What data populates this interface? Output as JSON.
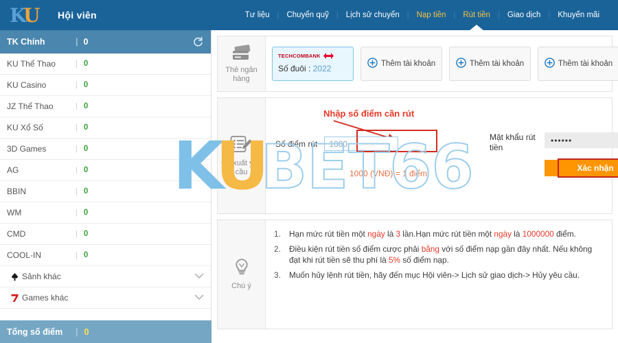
{
  "header": {
    "logo_alt": "KU",
    "brand_title": "Hội viên",
    "nav": [
      {
        "label": "Tư liệu",
        "state": "normal"
      },
      {
        "label": "Chuyển quỹ",
        "state": "normal"
      },
      {
        "label": "Lịch sử chuyển",
        "state": "normal"
      },
      {
        "label": "Nạp tiền",
        "state": "highlight"
      },
      {
        "label": "Rút tiền",
        "state": "active"
      },
      {
        "label": "Giao dịch",
        "state": "normal"
      },
      {
        "label": "Khuyến mãi",
        "state": "normal"
      }
    ],
    "separator": "|"
  },
  "sidebar": {
    "header": {
      "label": "TK Chính",
      "value": "0",
      "divider": "|",
      "refresh_icon": "refresh-icon"
    },
    "items": [
      {
        "label": "KU Thể Thao",
        "value": "0"
      },
      {
        "label": "KU Casino",
        "value": "0"
      },
      {
        "label": "JZ Thể Thao",
        "value": "0"
      },
      {
        "label": "KU Xổ Số",
        "value": "0"
      },
      {
        "label": "3D Games",
        "value": "0"
      },
      {
        "label": "AG",
        "value": "0"
      },
      {
        "label": "BBIN",
        "value": "0"
      },
      {
        "label": "WM",
        "value": "0"
      },
      {
        "label": "CMD",
        "value": "0"
      },
      {
        "label": "COOL-IN",
        "value": "0"
      }
    ],
    "groups": [
      {
        "label": "Sảnh khác",
        "icon": "spade-icon"
      },
      {
        "label": "Games khác",
        "icon": "seven-icon"
      }
    ],
    "total": {
      "label": "Tổng số điểm",
      "value": "0",
      "divider": "|"
    }
  },
  "bank_section": {
    "side_label": "Thẻ ngân hàng",
    "side_icon": "credit-card-icon",
    "selected_card": {
      "bank_name": "TECHCOMBANK",
      "tail_label": "Số đuôi :",
      "tail_number": "2022"
    },
    "add_buttons": [
      {
        "label": "Thêm tài khoản",
        "icon": "plus-circle-icon"
      },
      {
        "label": "Thêm tài khoản",
        "icon": "plus-circle-icon"
      },
      {
        "label": "Thêm tài khoản",
        "icon": "plus-circle-icon"
      }
    ]
  },
  "form_section": {
    "side_label": "Đề xuất yêu cầu",
    "side_icon": "form-edit-icon",
    "annotation_text": "Nhập số điểm cần rút",
    "amount_label": "Số điểm rút",
    "amount_value": "1000",
    "amount_placeholder": "1000",
    "rate_hint": "1000 (VNĐ) = 1 điểm",
    "password_label": "Mật khẩu rút tiền",
    "password_value": "••••••",
    "help_icon": "question-circle-icon",
    "confirm_label": "Xác nhận"
  },
  "note_section": {
    "side_label": "Chú ý",
    "side_icon": "lightbulb-icon",
    "notes": [
      {
        "parts": [
          {
            "t": "Hạn mức rút tiền một ",
            "c": "normal"
          },
          {
            "t": "ngày",
            "c": "red"
          },
          {
            "t": " là ",
            "c": "normal"
          },
          {
            "t": "3",
            "c": "red"
          },
          {
            "t": " lần.Hạn mức rút tiền một ",
            "c": "normal"
          },
          {
            "t": "ngày",
            "c": "red"
          },
          {
            "t": " là ",
            "c": "normal"
          },
          {
            "t": "1000000",
            "c": "red"
          },
          {
            "t": " điểm.",
            "c": "normal"
          }
        ]
      },
      {
        "parts": [
          {
            "t": "Điều kiện rút tiền số điểm cược phải ",
            "c": "normal"
          },
          {
            "t": "bằng",
            "c": "red"
          },
          {
            "t": " với số điểm nạp gần đây nhất. Nếu không đạt khi rút tiền sẽ thu phí là ",
            "c": "normal"
          },
          {
            "t": "5%",
            "c": "red"
          },
          {
            "t": " số điểm nạp.",
            "c": "normal"
          }
        ]
      },
      {
        "parts": [
          {
            "t": "Muốn hủy lệnh rút tiền, hãy đến mục Hội viên-> Lịch sử giao dịch-> Hủy yêu cầu.",
            "c": "normal"
          }
        ]
      }
    ]
  },
  "watermark": {
    "k": "K",
    "u": "U",
    "rest": "BET66"
  },
  "colors": {
    "header_blue": "#1a6399",
    "sidebar_head": "#4a86ad",
    "sidebar_total": "#75a6c4",
    "accent_gold": "#f5c242",
    "confirm_orange": "#ff9500",
    "annotation_red": "#d22b20",
    "value_green": "#3aa03a"
  }
}
